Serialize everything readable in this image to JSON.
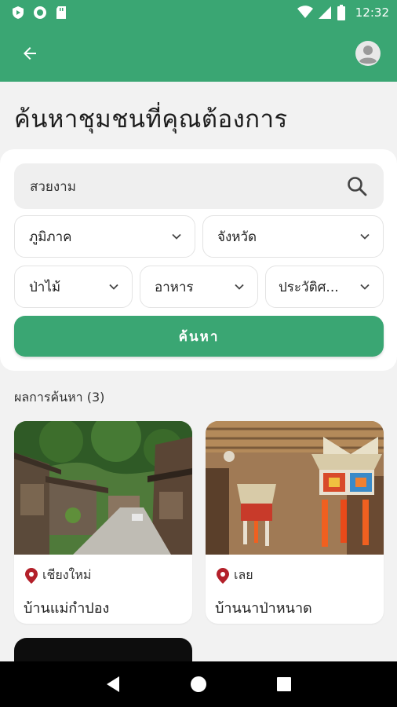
{
  "status_bar": {
    "time": "12:32"
  },
  "header": {
    "back_icon": "arrow-left-icon",
    "profile_icon": "account-circle-icon"
  },
  "page": {
    "title": "ค้นหาชุมชนที่คุณต้องการ"
  },
  "search": {
    "value": "สวยงาม",
    "filters": {
      "region": "ภูมิภาค",
      "province": "จังหวัด",
      "forest": "ป่าไม้",
      "food": "อาหาร",
      "history": "ประวัติศ..."
    },
    "button_label": "ค้นหา"
  },
  "results": {
    "label": "ผลการค้นหา (3)",
    "items": [
      {
        "province": "เชียงใหม่",
        "name": "บ้านแม่กำปอง"
      },
      {
        "province": "เลย",
        "name": "บ้านนาป่าหนาด"
      }
    ]
  },
  "colors": {
    "primary": "#3aa673",
    "pin": "#b3202a"
  }
}
